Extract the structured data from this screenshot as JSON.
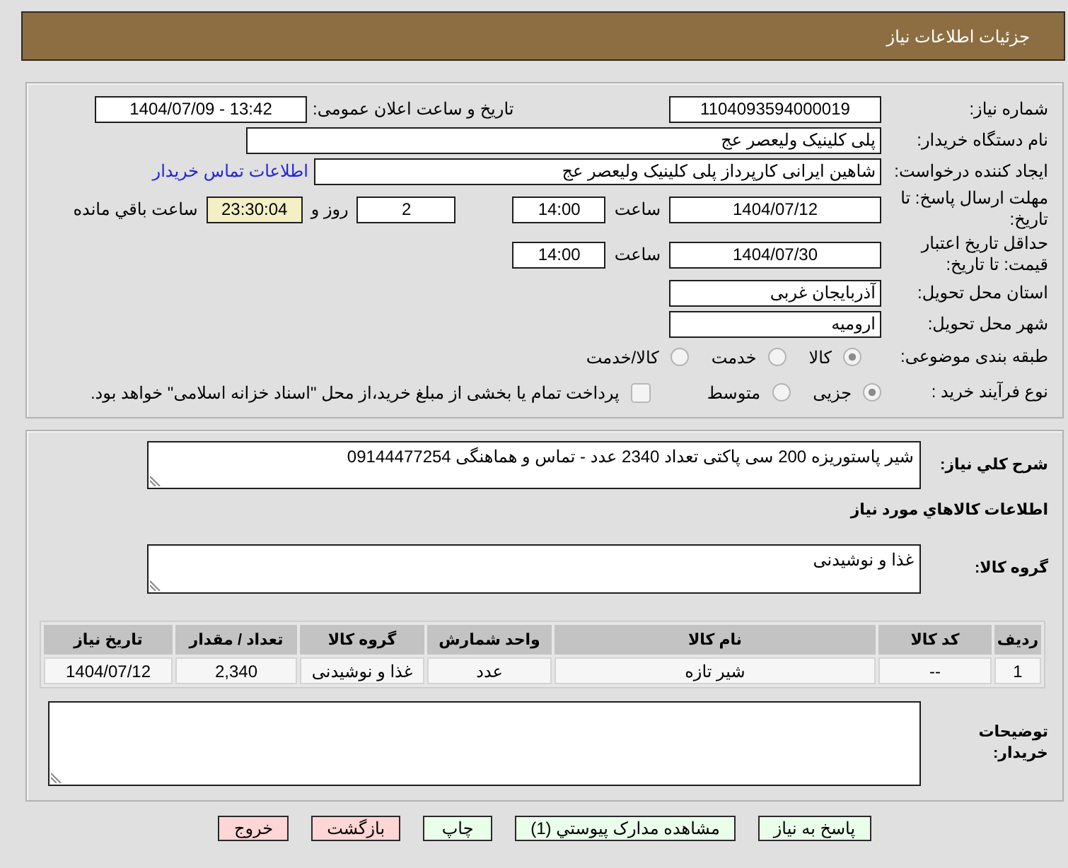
{
  "header": {
    "title": "جزئیات اطلاعات نیاز"
  },
  "details": {
    "need_number": {
      "label": "شماره نیاز:",
      "value": "1104093594000019"
    },
    "announce_date": {
      "label": "تاریخ و ساعت اعلان عمومی:",
      "value": "1404/07/09 - 13:42"
    },
    "buyer_org": {
      "label": "نام دستگاه خریدار:",
      "value": "پلی کلینیک ولیعصر عج"
    },
    "requester": {
      "label": "ایجاد کننده درخواست:",
      "value": "شاهین ایرانی کارپرداز پلی کلینیک ولیعصر عج",
      "contact_link": "اطلاعات تماس خریدار"
    },
    "reply_deadline": {
      "label": "مهلت ارسال پاسخ: تا تاریخ:",
      "date": "1404/07/12",
      "time_label": "ساعت",
      "time": "14:00",
      "days": "2",
      "days_label": "روز و",
      "remaining": "23:30:04",
      "remaining_label": "ساعت باقي مانده"
    },
    "price_validity": {
      "label": "حداقل تاریخ اعتبار قیمت: تا تاریخ:",
      "date": "1404/07/30",
      "time_label": "ساعت",
      "time": "14:00"
    },
    "province": {
      "label": "استان محل تحویل:",
      "value": "آذربایجان غربی"
    },
    "city": {
      "label": "شهر محل تحویل:",
      "value": "ارومیه"
    },
    "category": {
      "label": "طبقه بندی موضوعی:",
      "options": [
        {
          "label": "کالا",
          "selected": true
        },
        {
          "label": "خدمت",
          "selected": false
        },
        {
          "label": "کالا/خدمت",
          "selected": false
        }
      ]
    },
    "process_type": {
      "label": "نوع فرآیند خرید :",
      "options": [
        {
          "label": "جزیی",
          "selected": true
        },
        {
          "label": "متوسط",
          "selected": false
        }
      ],
      "treasury_option": {
        "label": "پرداخت تمام یا بخشی از مبلغ خرید،از محل \"اسناد خزانه اسلامی\" خواهد بود.",
        "checked": false
      }
    }
  },
  "needs": {
    "description": {
      "label": "شرح کلي نياز:",
      "value": "شیر پاستوریزه 200 سی پاکتی تعداد 2340 عدد - تماس و هماهنگی 09144477254"
    },
    "goods_heading": "اطلاعات کالاهاي مورد نياز",
    "goods_group": {
      "label": "گروه کالا:",
      "value": "غذا و نوشیدنی"
    },
    "table": {
      "columns": [
        "ردیف",
        "کد کالا",
        "نام کالا",
        "واحد شمارش",
        "گروه کالا",
        "تعداد / مقدار",
        "تاریخ نیاز"
      ],
      "rows": [
        [
          "1",
          "--",
          "شیر تازه",
          "عدد",
          "غذا و نوشیدنی",
          "2,340",
          "1404/07/12"
        ]
      ]
    },
    "buyer_notes": {
      "label": "توضیحات خریدار:"
    }
  },
  "buttons": [
    {
      "label": "پاسخ به نیاز",
      "kind": "primary"
    },
    {
      "label": "مشاهده مدارک پيوستي (1)",
      "kind": "primary"
    },
    {
      "label": "چاپ",
      "kind": "primary"
    },
    {
      "label": "بازگشت",
      "kind": "danger"
    },
    {
      "label": "خروج",
      "kind": "danger"
    }
  ]
}
